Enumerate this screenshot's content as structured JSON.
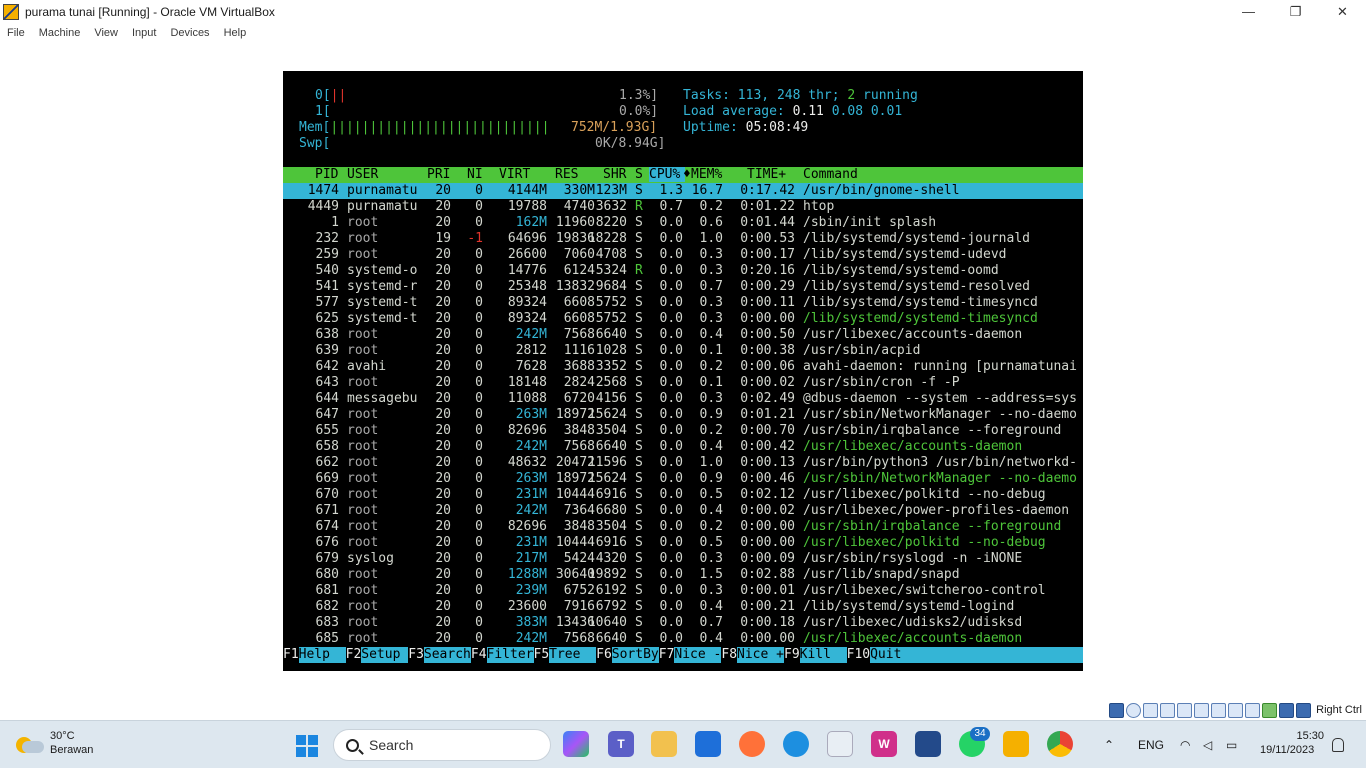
{
  "window": {
    "title": "purama tunai [Running] - Oracle VM VirtualBox",
    "minimize": "—",
    "restore": "❐",
    "close": "✕"
  },
  "menu": [
    "File",
    "Machine",
    "View",
    "Input",
    "Devices",
    "Help"
  ],
  "htop": {
    "cpu0_label": "0[",
    "cpu0_bar": "||",
    "cpu0_value": "1.3%]",
    "cpu1_label": "1[",
    "cpu1_value": "0.0%]",
    "mem_label": "Mem[",
    "mem_bar": "||||||||||||||||||||||||||||",
    "mem_value": "752M/1.93G]",
    "swp_label": "Swp[",
    "swp_value": "0K/8.94G]",
    "tasks_label": "Tasks:",
    "tasks_value": "113,",
    "thr_value": "248",
    "thr_label": "thr;",
    "running_value": "2",
    "running_label": "running",
    "load_label": "Load average:",
    "load_1": "0.11",
    "load_5": "0.08",
    "load_15": "0.01",
    "uptime_label": "Uptime:",
    "uptime_value": "05:08:49",
    "header": {
      "pid": "PID",
      "user": "USER",
      "pri": "PRI",
      "ni": "NI",
      "virt": "VIRT",
      "res": "RES",
      "shr": "SHR",
      "s": "S",
      "cpu": "CPU%",
      "sort": "♦",
      "mem": "MEM%",
      "time": "TIME+",
      "cmd": "Command"
    },
    "processes": [
      {
        "pid": "1474",
        "user": "purnamatu",
        "pri": "20",
        "ni": "0",
        "virt": "4144M",
        "res": "330M",
        "shr": "123M",
        "s": "S",
        "cpu": "1.3",
        "mem": "16.7",
        "time": "0:17.42",
        "cmd": "/usr/bin/gnome-shell"
      },
      {
        "pid": "4449",
        "user": "purnamatu",
        "pri": "20",
        "ni": "0",
        "virt": "19788",
        "res": "4740",
        "shr": "3632",
        "s": "R",
        "cpu": "0.7",
        "mem": "0.2",
        "time": "0:01.22",
        "cmd": "htop"
      },
      {
        "pid": "1",
        "user": "root",
        "pri": "20",
        "ni": "0",
        "virt": "162M",
        "res": "11960",
        "shr": "8220",
        "s": "S",
        "cpu": "0.0",
        "mem": "0.6",
        "time": "0:01.44",
        "cmd": "/sbin/init splash"
      },
      {
        "pid": "232",
        "user": "root",
        "pri": "19",
        "ni": "-1",
        "virt": "64696",
        "res": "19836",
        "shr": "18228",
        "s": "S",
        "cpu": "0.0",
        "mem": "1.0",
        "time": "0:00.53",
        "cmd": "/lib/systemd/systemd-journald"
      },
      {
        "pid": "259",
        "user": "root",
        "pri": "20",
        "ni": "0",
        "virt": "26600",
        "res": "7060",
        "shr": "4708",
        "s": "S",
        "cpu": "0.0",
        "mem": "0.3",
        "time": "0:00.17",
        "cmd": "/lib/systemd/systemd-udevd"
      },
      {
        "pid": "540",
        "user": "systemd-o",
        "pri": "20",
        "ni": "0",
        "virt": "14776",
        "res": "6124",
        "shr": "5324",
        "s": "R",
        "cpu": "0.0",
        "mem": "0.3",
        "time": "0:20.16",
        "cmd": "/lib/systemd/systemd-oomd"
      },
      {
        "pid": "541",
        "user": "systemd-r",
        "pri": "20",
        "ni": "0",
        "virt": "25348",
        "res": "13832",
        "shr": "9684",
        "s": "S",
        "cpu": "0.0",
        "mem": "0.7",
        "time": "0:00.29",
        "cmd": "/lib/systemd/systemd-resolved"
      },
      {
        "pid": "577",
        "user": "systemd-t",
        "pri": "20",
        "ni": "0",
        "virt": "89324",
        "res": "6608",
        "shr": "5752",
        "s": "S",
        "cpu": "0.0",
        "mem": "0.3",
        "time": "0:00.11",
        "cmd": "/lib/systemd/systemd-timesyncd"
      },
      {
        "pid": "625",
        "user": "systemd-t",
        "pri": "20",
        "ni": "0",
        "virt": "89324",
        "res": "6608",
        "shr": "5752",
        "s": "S",
        "cpu": "0.0",
        "mem": "0.3",
        "time": "0:00.00",
        "cmd": "/lib/systemd/systemd-timesyncd",
        "thread": true
      },
      {
        "pid": "638",
        "user": "root",
        "pri": "20",
        "ni": "0",
        "virt": "242M",
        "res": "7568",
        "shr": "6640",
        "s": "S",
        "cpu": "0.0",
        "mem": "0.4",
        "time": "0:00.50",
        "cmd": "/usr/libexec/accounts-daemon"
      },
      {
        "pid": "639",
        "user": "root",
        "pri": "20",
        "ni": "0",
        "virt": "2812",
        "res": "1116",
        "shr": "1028",
        "s": "S",
        "cpu": "0.0",
        "mem": "0.1",
        "time": "0:00.38",
        "cmd": "/usr/sbin/acpid"
      },
      {
        "pid": "642",
        "user": "avahi",
        "pri": "20",
        "ni": "0",
        "virt": "7628",
        "res": "3688",
        "shr": "3352",
        "s": "S",
        "cpu": "0.0",
        "mem": "0.2",
        "time": "0:00.06",
        "cmd": "avahi-daemon: running [purnamatunai"
      },
      {
        "pid": "643",
        "user": "root",
        "pri": "20",
        "ni": "0",
        "virt": "18148",
        "res": "2824",
        "shr": "2568",
        "s": "S",
        "cpu": "0.0",
        "mem": "0.1",
        "time": "0:00.02",
        "cmd": "/usr/sbin/cron -f -P"
      },
      {
        "pid": "644",
        "user": "messagebu",
        "pri": "20",
        "ni": "0",
        "virt": "11088",
        "res": "6720",
        "shr": "4156",
        "s": "S",
        "cpu": "0.0",
        "mem": "0.3",
        "time": "0:02.49",
        "cmd": "@dbus-daemon --system --address=sys"
      },
      {
        "pid": "647",
        "user": "root",
        "pri": "20",
        "ni": "0",
        "virt": "263M",
        "res": "18972",
        "shr": "15624",
        "s": "S",
        "cpu": "0.0",
        "mem": "0.9",
        "time": "0:01.21",
        "cmd": "/usr/sbin/NetworkManager --no-daemo"
      },
      {
        "pid": "655",
        "user": "root",
        "pri": "20",
        "ni": "0",
        "virt": "82696",
        "res": "3848",
        "shr": "3504",
        "s": "S",
        "cpu": "0.0",
        "mem": "0.2",
        "time": "0:00.70",
        "cmd": "/usr/sbin/irqbalance --foreground"
      },
      {
        "pid": "658",
        "user": "root",
        "pri": "20",
        "ni": "0",
        "virt": "242M",
        "res": "7568",
        "shr": "6640",
        "s": "S",
        "cpu": "0.0",
        "mem": "0.4",
        "time": "0:00.42",
        "cmd": "/usr/libexec/accounts-daemon",
        "thread": true
      },
      {
        "pid": "662",
        "user": "root",
        "pri": "20",
        "ni": "0",
        "virt": "48632",
        "res": "20472",
        "shr": "11596",
        "s": "S",
        "cpu": "0.0",
        "mem": "1.0",
        "time": "0:00.13",
        "cmd": "/usr/bin/python3 /usr/bin/networkd-"
      },
      {
        "pid": "669",
        "user": "root",
        "pri": "20",
        "ni": "0",
        "virt": "263M",
        "res": "18972",
        "shr": "15624",
        "s": "S",
        "cpu": "0.0",
        "mem": "0.9",
        "time": "0:00.46",
        "cmd": "/usr/sbin/NetworkManager --no-daemo",
        "thread": true
      },
      {
        "pid": "670",
        "user": "root",
        "pri": "20",
        "ni": "0",
        "virt": "231M",
        "res": "10444",
        "shr": "6916",
        "s": "S",
        "cpu": "0.0",
        "mem": "0.5",
        "time": "0:02.12",
        "cmd": "/usr/libexec/polkitd --no-debug"
      },
      {
        "pid": "671",
        "user": "root",
        "pri": "20",
        "ni": "0",
        "virt": "242M",
        "res": "7364",
        "shr": "6680",
        "s": "S",
        "cpu": "0.0",
        "mem": "0.4",
        "time": "0:00.02",
        "cmd": "/usr/libexec/power-profiles-daemon"
      },
      {
        "pid": "674",
        "user": "root",
        "pri": "20",
        "ni": "0",
        "virt": "82696",
        "res": "3848",
        "shr": "3504",
        "s": "S",
        "cpu": "0.0",
        "mem": "0.2",
        "time": "0:00.00",
        "cmd": "/usr/sbin/irqbalance --foreground",
        "thread": true
      },
      {
        "pid": "676",
        "user": "root",
        "pri": "20",
        "ni": "0",
        "virt": "231M",
        "res": "10444",
        "shr": "6916",
        "s": "S",
        "cpu": "0.0",
        "mem": "0.5",
        "time": "0:00.00",
        "cmd": "/usr/libexec/polkitd --no-debug",
        "thread": true
      },
      {
        "pid": "679",
        "user": "syslog",
        "pri": "20",
        "ni": "0",
        "virt": "217M",
        "res": "5424",
        "shr": "4320",
        "s": "S",
        "cpu": "0.0",
        "mem": "0.3",
        "time": "0:00.09",
        "cmd": "/usr/sbin/rsyslogd -n -iNONE"
      },
      {
        "pid": "680",
        "user": "root",
        "pri": "20",
        "ni": "0",
        "virt": "1288M",
        "res": "30640",
        "shr": "19892",
        "s": "S",
        "cpu": "0.0",
        "mem": "1.5",
        "time": "0:02.88",
        "cmd": "/usr/lib/snapd/snapd"
      },
      {
        "pid": "681",
        "user": "root",
        "pri": "20",
        "ni": "0",
        "virt": "239M",
        "res": "6752",
        "shr": "6192",
        "s": "S",
        "cpu": "0.0",
        "mem": "0.3",
        "time": "0:00.01",
        "cmd": "/usr/libexec/switcheroo-control"
      },
      {
        "pid": "682",
        "user": "root",
        "pri": "20",
        "ni": "0",
        "virt": "23600",
        "res": "7916",
        "shr": "6792",
        "s": "S",
        "cpu": "0.0",
        "mem": "0.4",
        "time": "0:00.21",
        "cmd": "/lib/systemd/systemd-logind"
      },
      {
        "pid": "683",
        "user": "root",
        "pri": "20",
        "ni": "0",
        "virt": "383M",
        "res": "13436",
        "shr": "10640",
        "s": "S",
        "cpu": "0.0",
        "mem": "0.7",
        "time": "0:00.18",
        "cmd": "/usr/libexec/udisks2/udisksd"
      },
      {
        "pid": "685",
        "user": "root",
        "pri": "20",
        "ni": "0",
        "virt": "242M",
        "res": "7568",
        "shr": "6640",
        "s": "S",
        "cpu": "0.0",
        "mem": "0.4",
        "time": "0:00.00",
        "cmd": "/usr/libexec/accounts-daemon",
        "thread": true
      }
    ],
    "fkeys": [
      {
        "key": "F1",
        "label": "Help  "
      },
      {
        "key": "F2",
        "label": "Setup "
      },
      {
        "key": "F3",
        "label": "Search"
      },
      {
        "key": "F4",
        "label": "Filter"
      },
      {
        "key": "F5",
        "label": "Tree  "
      },
      {
        "key": "F6",
        "label": "SortBy"
      },
      {
        "key": "F7",
        "label": "Nice -"
      },
      {
        "key": "F8",
        "label": "Nice +"
      },
      {
        "key": "F9",
        "label": "Kill  "
      },
      {
        "key": "F10",
        "label": "Quit  "
      }
    ]
  },
  "vbox_status": {
    "host_key": "Right Ctrl"
  },
  "taskbar": {
    "temperature": "30°C",
    "weather": "Berawan",
    "search_label": "Search",
    "whatsapp_badge": "34",
    "language": "ENG",
    "time": "15:30",
    "date": "19/11/2023"
  }
}
